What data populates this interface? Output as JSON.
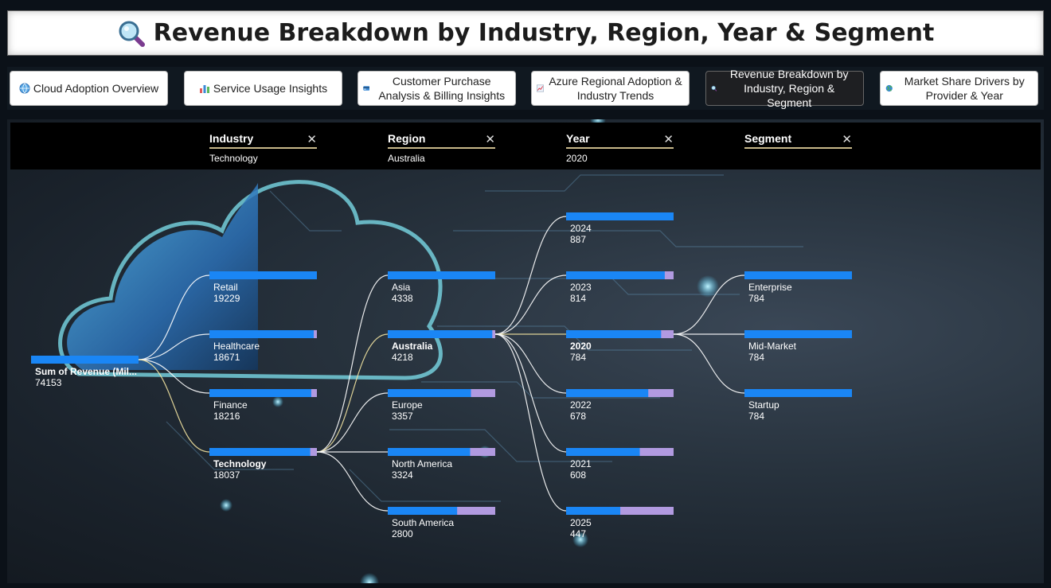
{
  "title": {
    "icon": "magnifying-glass-icon",
    "text": "Revenue Breakdown by Industry, Region, Year & Segment"
  },
  "nav": [
    {
      "icon": "globe-icon",
      "label": "Cloud Adoption Overview",
      "active": false
    },
    {
      "icon": "bar-chart-icon",
      "label": "Service Usage Insights",
      "active": false
    },
    {
      "icon": "credit-card-icon",
      "label": "Customer Purchase Analysis & Billing Insights",
      "active": false
    },
    {
      "icon": "line-chart-icon",
      "label": "Azure Regional Adoption & Industry Trends",
      "active": false
    },
    {
      "icon": "magnifying-glass-icon",
      "label": "Revenue Breakdown by Industry, Region & Segment",
      "active": true
    },
    {
      "icon": "earth-icon",
      "label": "Market Share Drivers by Provider & Year",
      "active": false
    }
  ],
  "filters": [
    {
      "name": "Industry",
      "value": "Technology",
      "close": "✕"
    },
    {
      "name": "Region",
      "value": "Australia",
      "close": "✕"
    },
    {
      "name": "Year",
      "value": "2020",
      "close": "✕"
    },
    {
      "name": "Segment",
      "value": "",
      "close": "✕"
    }
  ],
  "colors": {
    "bar": "#1a86f5",
    "remainder": "#b19ae0",
    "link": "#ffffff",
    "selected_link": "#f2e3a1"
  },
  "chart_data": {
    "type": "decomposition-tree",
    "root": {
      "label": "Sum of Revenue (Mil...",
      "value": 74153
    },
    "levels": [
      {
        "name": "Industry",
        "selected": "Technology",
        "nodes": [
          {
            "label": "Retail",
            "value": 19229
          },
          {
            "label": "Healthcare",
            "value": 18671
          },
          {
            "label": "Finance",
            "value": 18216
          },
          {
            "label": "Technology",
            "value": 18037
          }
        ]
      },
      {
        "name": "Region",
        "selected": "Australia",
        "nodes": [
          {
            "label": "Asia",
            "value": 4338
          },
          {
            "label": "Australia",
            "value": 4218
          },
          {
            "label": "Europe",
            "value": 3357
          },
          {
            "label": "North America",
            "value": 3324
          },
          {
            "label": "South America",
            "value": 2800
          }
        ]
      },
      {
        "name": "Year",
        "selected": "2020",
        "nodes": [
          {
            "label": "2024",
            "value": 887
          },
          {
            "label": "2023",
            "value": 814
          },
          {
            "label": "2020",
            "value": 784
          },
          {
            "label": "2022",
            "value": 678
          },
          {
            "label": "2021",
            "value": 608
          },
          {
            "label": "2025",
            "value": 447
          }
        ]
      },
      {
        "name": "Segment",
        "selected": null,
        "nodes": [
          {
            "label": "Enterprise",
            "value": 784
          },
          {
            "label": "Mid-Market",
            "value": 784
          },
          {
            "label": "Startup",
            "value": 784
          }
        ]
      }
    ]
  }
}
